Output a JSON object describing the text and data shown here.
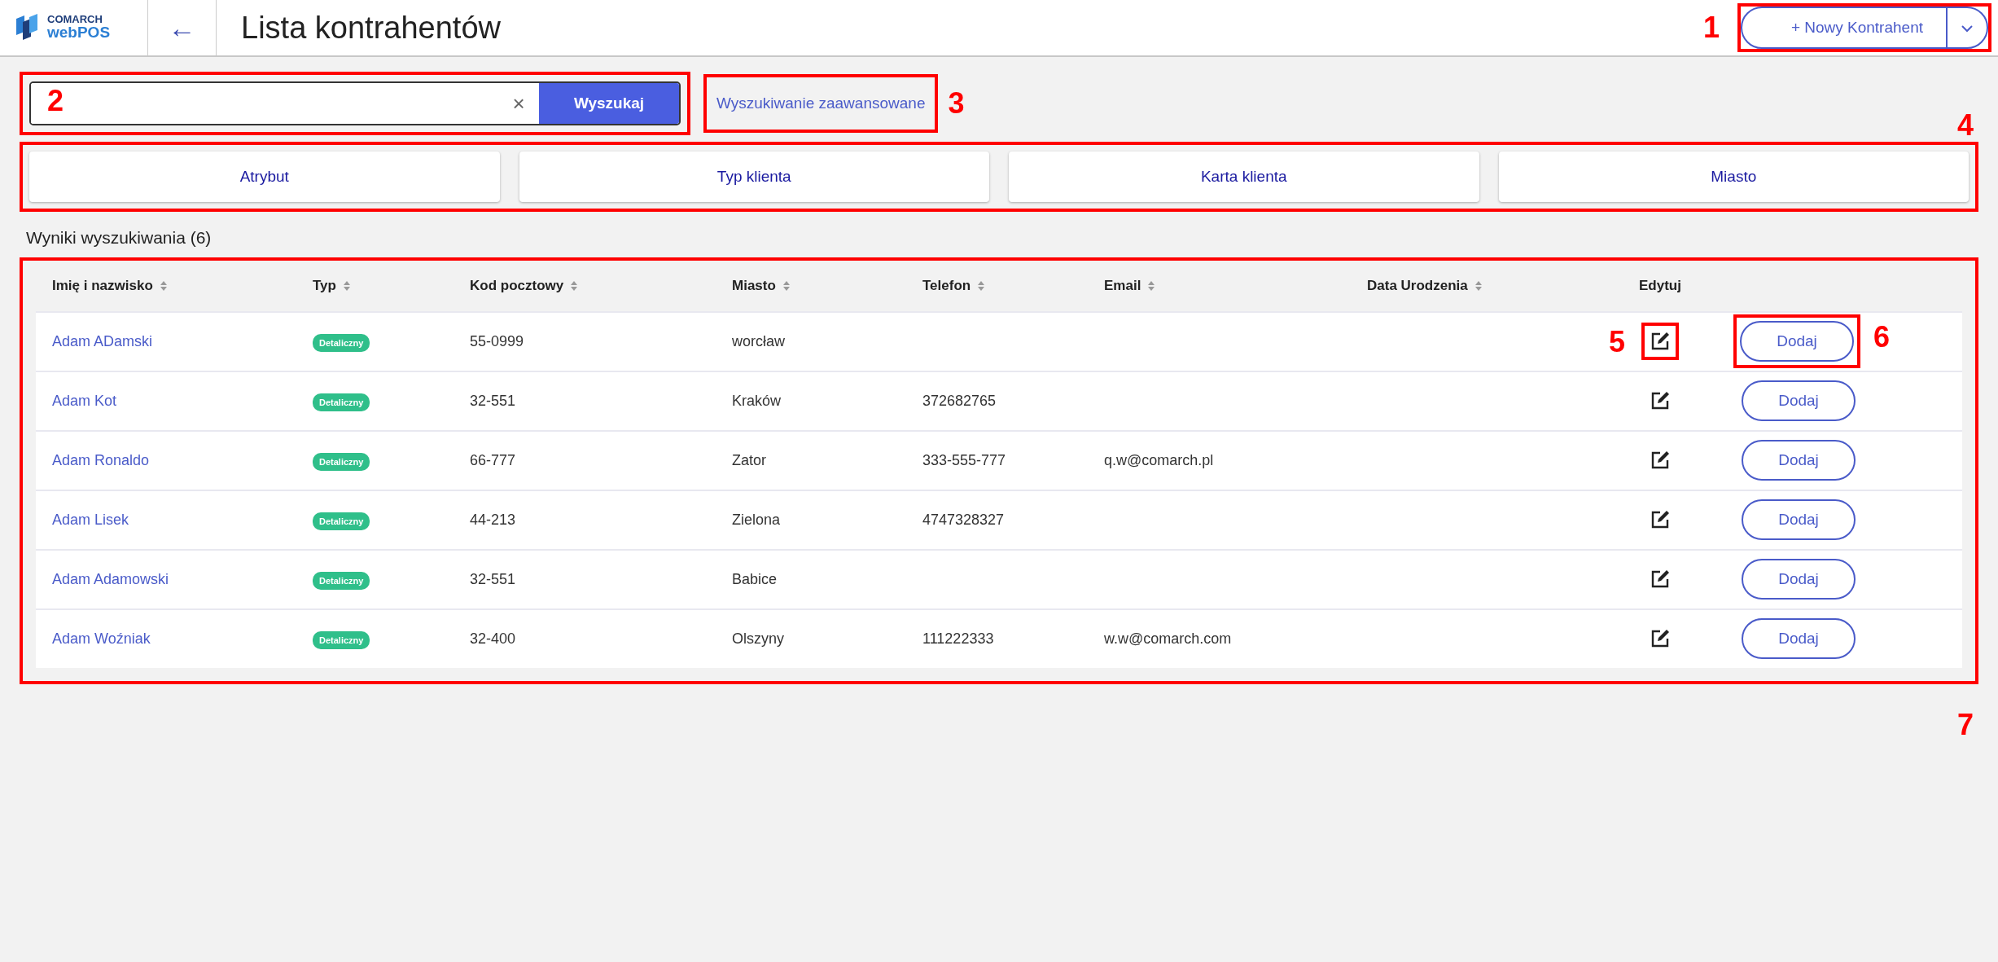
{
  "header": {
    "logo_top": "COMARCH",
    "logo_bottom": "webPOS",
    "back": "←",
    "title": "Lista kontrahentów",
    "new_button": "+ Nowy Kontrahent",
    "new_button_callout": "1"
  },
  "search": {
    "callout": "2",
    "clear": "×",
    "button": "Wyszukaj",
    "advanced": "Wyszukiwanie zaawansowane",
    "advanced_callout": "3"
  },
  "filters_callout": "4",
  "filters": [
    "Atrybut",
    "Typ klienta",
    "Karta klienta",
    "Miasto"
  ],
  "results_label": "Wyniki wyszukiwania (6)",
  "table": {
    "callout": "7",
    "edit_callout": "5",
    "add_callout": "6",
    "columns": [
      "Imię i nazwisko",
      "Typ",
      "Kod pocztowy",
      "Miasto",
      "Telefon",
      "Email",
      "Data Urodzenia",
      "Edytuj"
    ],
    "rows": [
      {
        "name": "Adam ADamski",
        "type": "Detaliczny",
        "postal": "55-0999",
        "city": "worcław",
        "phone": "",
        "email": "",
        "birth": "",
        "add": "Dodaj"
      },
      {
        "name": "Adam Kot",
        "type": "Detaliczny",
        "postal": "32-551",
        "city": "Kraków",
        "phone": "372682765",
        "email": "",
        "birth": "",
        "add": "Dodaj"
      },
      {
        "name": "Adam Ronaldo",
        "type": "Detaliczny",
        "postal": "66-777",
        "city": "Zator",
        "phone": "333-555-777",
        "email": "q.w@comarch.pl",
        "birth": "",
        "add": "Dodaj"
      },
      {
        "name": "Adam Lisek",
        "type": "Detaliczny",
        "postal": "44-213",
        "city": "Zielona",
        "phone": "4747328327",
        "email": "",
        "birth": "",
        "add": "Dodaj"
      },
      {
        "name": "Adam Adamowski",
        "type": "Detaliczny",
        "postal": "32-551",
        "city": "Babice",
        "phone": "",
        "email": "",
        "birth": "",
        "add": "Dodaj"
      },
      {
        "name": "Adam Woźniak",
        "type": "Detaliczny",
        "postal": "32-400",
        "city": "Olszyny",
        "phone": "111222333",
        "email": "w.w@comarch.com",
        "birth": "",
        "add": "Dodaj"
      }
    ]
  }
}
